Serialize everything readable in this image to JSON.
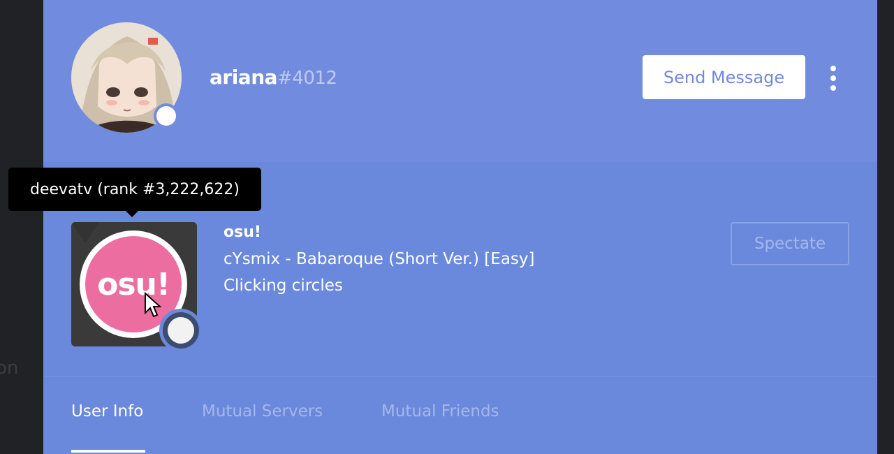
{
  "background": {
    "partial_text": "on"
  },
  "profile": {
    "username": "ariana",
    "discriminator": "#4012",
    "status": "online",
    "send_message_label": "Send Message",
    "more_icon": "vertical-ellipsis-icon"
  },
  "activity": {
    "game_name": "osu!",
    "icon_text": "osu!",
    "details": "cYsmix - Babaroque (Short Ver.) [Easy]",
    "state": "Clicking circles",
    "spectate_label": "Spectate",
    "tooltip": "deevatv (rank #3,222,622)"
  },
  "tabs": [
    {
      "label": "User Info",
      "active": true
    },
    {
      "label": "Mutual Servers",
      "active": false
    },
    {
      "label": "Mutual Friends",
      "active": false
    }
  ],
  "colors": {
    "header": "#718bde",
    "body": "#6a88dc",
    "osu_pink": "#ec6ea1",
    "button_text": "#7289da"
  }
}
